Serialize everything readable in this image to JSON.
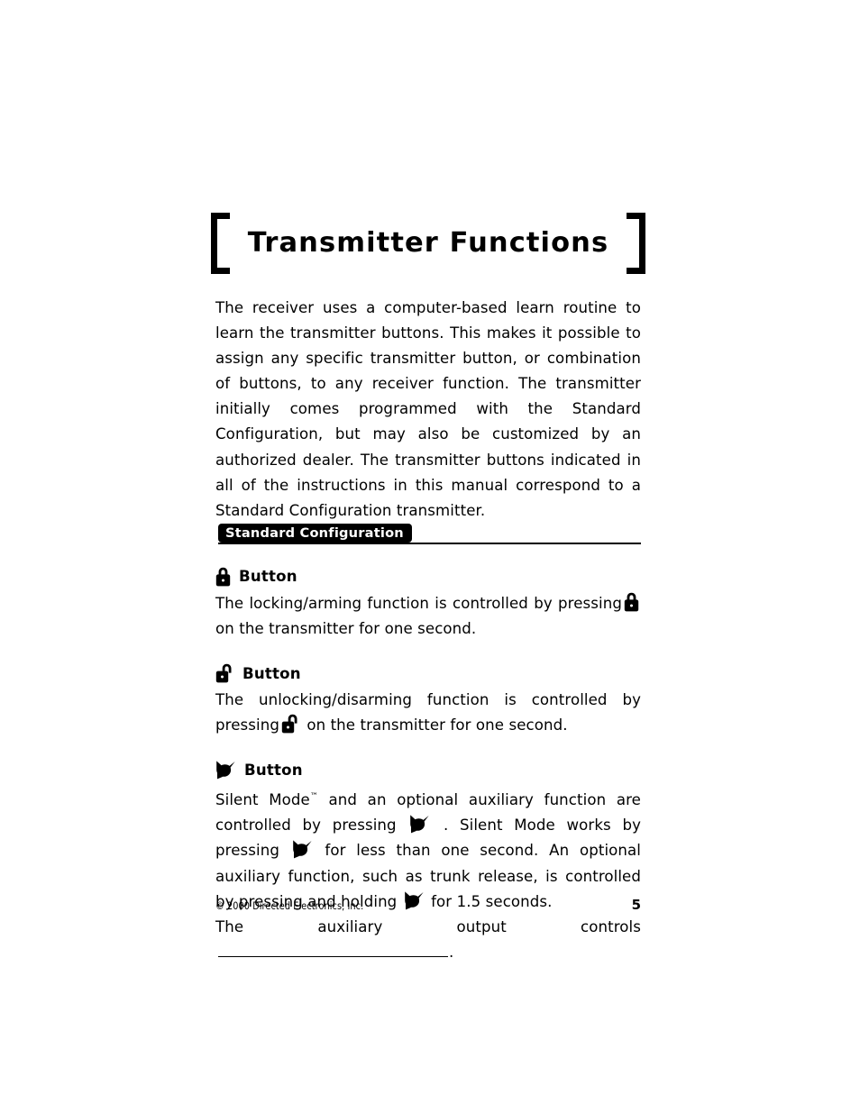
{
  "document": {
    "title": "Transmitter Functions",
    "intro_paragraph": "The receiver uses a computer-based learn routine to learn the transmitter buttons. This makes it possible to assign any specific transmitter button, or combination of buttons, to any receiver function. The transmitter initially comes programmed with the Standard Configuration, but may also be customized by an authorized dealer. The transmitter buttons indicated in all of the instructions in this manual correspond to a Standard Configuration transmitter."
  },
  "section_banner": {
    "label": "Standard Configuration"
  },
  "subsections": [
    {
      "icon": "lock-icon",
      "heading": "Button",
      "text_before_icon": "The locking/arming function is controlled by pressing",
      "inline_icon": "lock-icon",
      "text_after_icon": "on the transmitter for one second."
    },
    {
      "icon": "unlock-icon",
      "heading": "Button",
      "text_before_icon": "The unlocking/disarming function is controlled by pressing",
      "inline_icon": "unlock-icon",
      "text_after_icon": "on the transmitter for one second."
    },
    {
      "icon": "aux-icon",
      "heading": "Button",
      "silent_mode_part1": "Silent Mode",
      "trademark": "™",
      "silent_mode_part2": "and an optional auxiliary function are controlled by pressing",
      "silent_mode_part3": ". Silent Mode works by pressing",
      "silent_mode_part4": "for less than one second. An optional auxiliary function, such as trunk release, is controlled by pressing and holding",
      "silent_mode_part5": "for 1.5 seconds.",
      "aux_output_label": "The auxiliary output controls",
      "aux_output_blank_end": "."
    }
  ],
  "footer": {
    "copyright": "© 2000 Directed Electronics, Inc.",
    "page_number": "5"
  },
  "colors": {
    "ink": "#000000",
    "paper": "#ffffff",
    "banner_bg": "#000000",
    "banner_text": "#ffffff"
  }
}
